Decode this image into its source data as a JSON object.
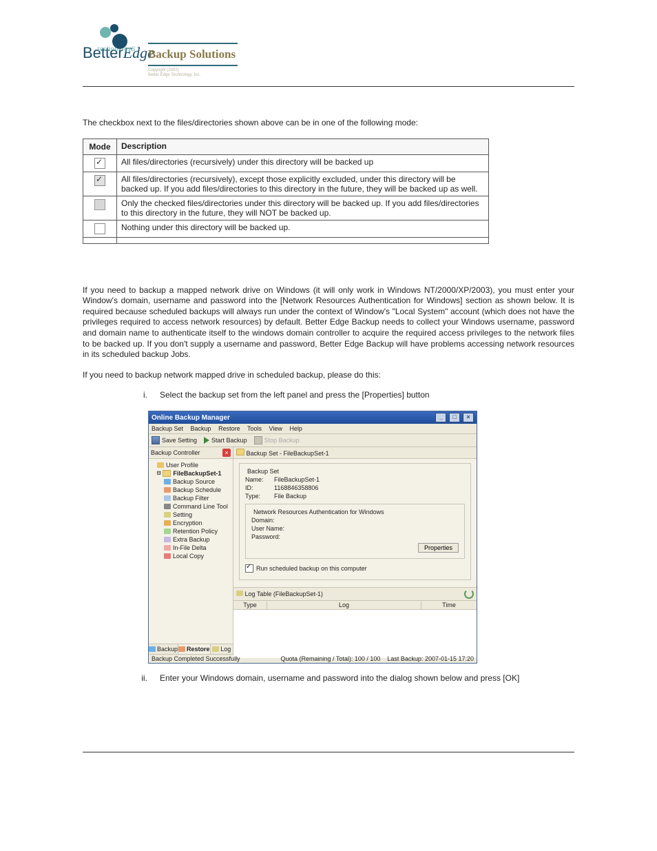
{
  "header": {
    "brand_top": "BetterEdge",
    "brand_sub": "technology",
    "product_title": "Backup Solutions",
    "copyright_l1": "Copyright (2002)",
    "copyright_l2": "Better Edge Technology, Inc."
  },
  "intro_para": "The checkbox next to the files/directories shown above can be in one of the following mode:",
  "table": {
    "head_mode": "Mode",
    "head_desc": "Description",
    "rows": [
      {
        "desc": "All files/directories (recursively) under this directory will be backed up"
      },
      {
        "desc": "All files/directories (recursively), except those explicitly excluded, under this directory will be backed up. If you add files/directories to this directory in the future, they will be backed up as well."
      },
      {
        "desc": "Only the checked files/directories under this directory will be backed up. If you add files/directories to this directory in the future, they will NOT be backed up."
      },
      {
        "desc": "Nothing under this directory will be backed up."
      }
    ]
  },
  "para_network": "If you need to backup a mapped network drive on Windows (it will only work in Windows NT/2000/XP/2003), you must enter your Window's domain, username and password into the [Network Resources Authentication for Windows] section as shown below. It is required because scheduled backups will always run under the context of Window's \"Local System\" account (which does not have the privileges required to access network resources) by default. Better Edge Backup needs to collect your Windows username, password and domain name to authenticate itself to the windows domain controller to acquire the required access privileges to the network files to be backed up. If you don't supply a username and password, Better Edge Backup will have problems accessing network resources in its scheduled backup Jobs.",
  "para_steps_intro": "If you need to backup network mapped drive in scheduled backup, please do this:",
  "steps": {
    "i_num": "i.",
    "i_text": "Select the backup set from the left panel and press the [Properties] button",
    "ii_num": "ii.",
    "ii_text": "Enter your Windows domain, username and password into the dialog shown below and press [OK]"
  },
  "app": {
    "title": "Online Backup Manager",
    "menu": {
      "backup_set": "Backup Set",
      "backup": "Backup",
      "restore": "Restore",
      "tools": "Tools",
      "view": "View",
      "help": "Help"
    },
    "toolbar": {
      "save": "Save Setting",
      "start": "Start Backup",
      "stop": "Stop Backup"
    },
    "leftpane_title": "Backup Controller",
    "tree": {
      "user_profile": "User Profile",
      "set": "FileBackupSet-1",
      "source": "Backup Source",
      "schedule": "Backup Schedule",
      "filter": "Backup Filter",
      "cli": "Command Line Tool",
      "setting": "Setting",
      "encryption": "Encryption",
      "retention": "Retention Policy",
      "extra": "Extra Backup",
      "delta": "In-File Delta",
      "local": "Local Copy"
    },
    "lefttabs": {
      "backup": "Backup",
      "restore": "Restore",
      "log": "Log"
    },
    "right": {
      "title": "Backup Set - FileBackupSet-1",
      "legend": "Backup Set",
      "name_k": "Name:",
      "name_v": "FileBackupSet-1",
      "id_k": "ID:",
      "id_v": "1168846358806",
      "type_k": "Type:",
      "type_v": "File Backup",
      "inner_legend": "Network Resources Authentication for Windows",
      "domain_k": "Domain:",
      "user_k": "User Name:",
      "pass_k": "Password:",
      "props_btn": "Properties",
      "run_label": "Run scheduled backup on this computer"
    },
    "log": {
      "title": "Log Table (FileBackupSet-1)",
      "col_type": "Type",
      "col_log": "Log",
      "col_time": "Time"
    },
    "status": {
      "left": "Backup Completed Successfully",
      "quota": "Quota (Remaining / Total): 100 / 100",
      "last": "Last Backup: 2007-01-15 17:20"
    }
  }
}
